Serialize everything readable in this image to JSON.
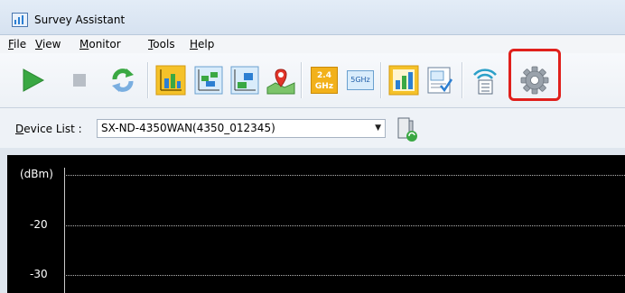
{
  "window": {
    "title": "Survey Assistant"
  },
  "menu": [
    {
      "prefix": "",
      "accel": "F",
      "rest": "ile"
    },
    {
      "prefix": "",
      "accel": "V",
      "rest": "iew"
    },
    {
      "prefix": "",
      "accel": "M",
      "rest": "onitor"
    },
    {
      "prefix": "",
      "accel": "T",
      "rest": "ools"
    },
    {
      "prefix": "",
      "accel": "H",
      "rest": "elp"
    }
  ],
  "toolbar": {
    "band_24_top": "2.4",
    "band_24_bottom": "GHz",
    "band_5": "5GHz",
    "icons": [
      "play-icon",
      "stop-icon",
      "refresh-icon",
      "channel-view-icon",
      "channel-overlap-icon",
      "channel-list-icon",
      "map-location-icon",
      "band-2-4ghz-icon",
      "band-5ghz-icon",
      "signal-bar-chart-icon",
      "report-icon",
      "device-info-icon",
      "settings-gear-icon"
    ],
    "highlighted": "settings-gear-icon",
    "colors": {
      "highlight": "#e0201c",
      "play": "#3aa843",
      "accent_yellow": "#f2b11b",
      "accent_blue": "#2c7fd2"
    }
  },
  "device_list": {
    "label_prefix": "",
    "label_accel": "D",
    "label_rest": "evice List :",
    "selected": "SX-ND-4350WAN(4350_012345)"
  },
  "chart": {
    "y_unit": "(dBm)",
    "y_ticks": [
      "-20",
      "-30"
    ],
    "background": "#000000"
  }
}
